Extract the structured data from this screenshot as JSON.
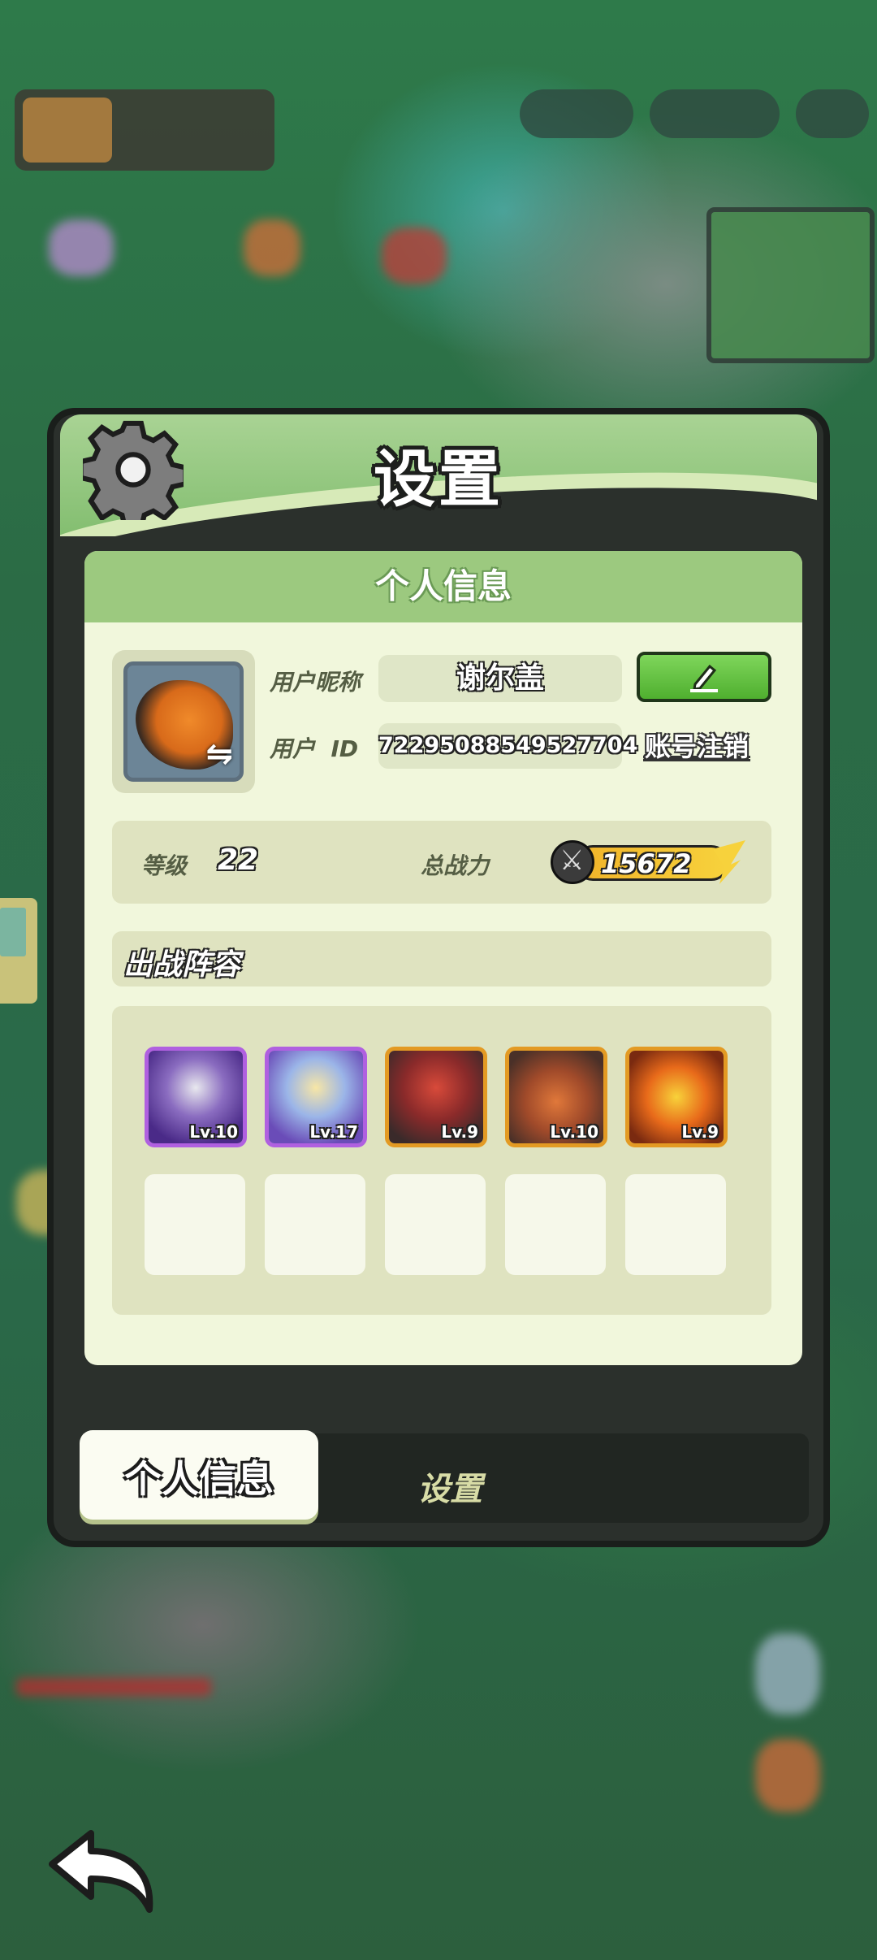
{
  "dialog": {
    "title": "设置",
    "icon": "gear-icon"
  },
  "profile": {
    "section_title": "个人信息",
    "nickname_label": "用户昵称",
    "nickname": "谢尔盖",
    "id_label": "用户  ID",
    "user_id": "72295088549527704",
    "edit_icon": "edit-pencil-icon",
    "cancel_account_label": "账号注销"
  },
  "stats": {
    "level_label": "等级",
    "level": "22",
    "power_label": "总战力",
    "power": "15672"
  },
  "lineup": {
    "title": "出战阵容",
    "heroes": [
      {
        "level": "Lv.10",
        "rarity": "epic"
      },
      {
        "level": "Lv.17",
        "rarity": "epic"
      },
      {
        "level": "Lv.9",
        "rarity": "legendary"
      },
      {
        "level": "Lv.10",
        "rarity": "legendary"
      },
      {
        "level": "Lv.9",
        "rarity": "legendary"
      }
    ],
    "empty_slots": 5
  },
  "tabs": [
    {
      "label": "个人信息",
      "active": true
    },
    {
      "label": "设置",
      "active": false
    }
  ],
  "colors": {
    "header_green": "#9cc97f",
    "epic_border": "#b060e0",
    "legendary_border": "#e39a23",
    "button_green": "#4faf2f"
  },
  "back": {
    "icon": "back-arrow-icon"
  }
}
